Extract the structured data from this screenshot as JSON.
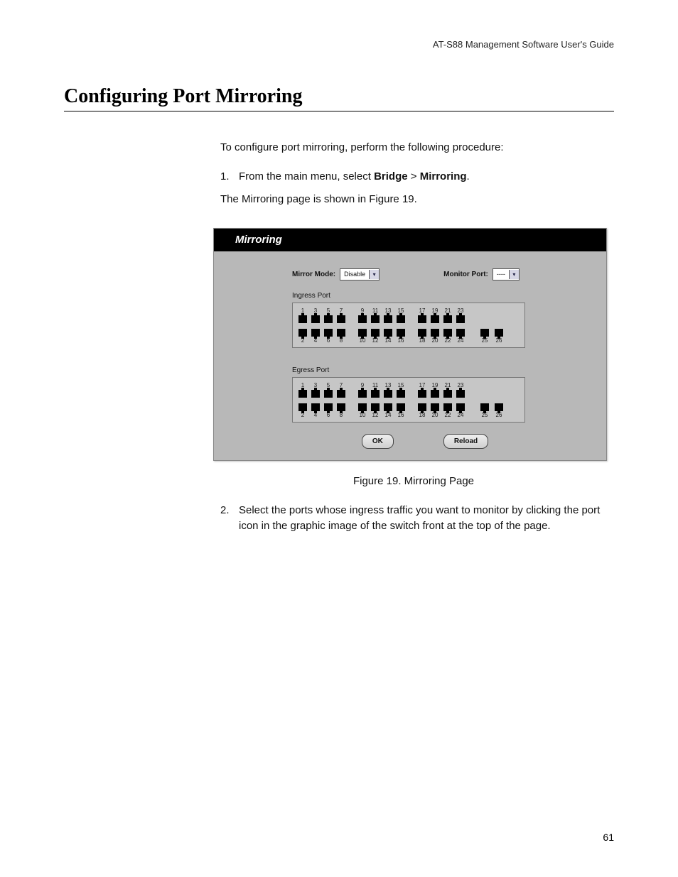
{
  "running_head": "AT-S88 Management Software User's Guide",
  "section_title": "Configuring Port Mirroring",
  "intro": "To configure port mirroring, perform the following procedure:",
  "steps": [
    {
      "num": "1.",
      "text_pre": "From the main menu, select ",
      "bold1": "Bridge",
      "sep": " > ",
      "bold2": "Mirroring",
      "text_post": ".",
      "follow": "The Mirroring page is shown in Figure 19."
    },
    {
      "num": "2.",
      "text": "Select the ports whose ingress traffic you want to monitor by clicking the port icon in the graphic image of the switch front at the top of the page."
    }
  ],
  "figure": {
    "title": "Mirroring",
    "mirror_mode_label": "Mirror Mode:",
    "mirror_mode_value": "Disable",
    "monitor_port_label": "Monitor Port:",
    "monitor_port_value": "----",
    "ingress_label": "Ingress Port",
    "egress_label": "Egress Port",
    "port_groups_top": [
      [
        "1",
        "3",
        "5",
        "7"
      ],
      [
        "9",
        "11",
        "13",
        "15"
      ],
      [
        "17",
        "19",
        "21",
        "23"
      ]
    ],
    "port_groups_bottom": [
      [
        "2",
        "4",
        "6",
        "8"
      ],
      [
        "10",
        "12",
        "14",
        "16"
      ],
      [
        "18",
        "20",
        "22",
        "24"
      ]
    ],
    "port_extra_bottom": [
      "25",
      "26"
    ],
    "ok_label": "OK",
    "reload_label": "Reload",
    "caption": "Figure 19. Mirroring Page"
  },
  "page_number": "61"
}
